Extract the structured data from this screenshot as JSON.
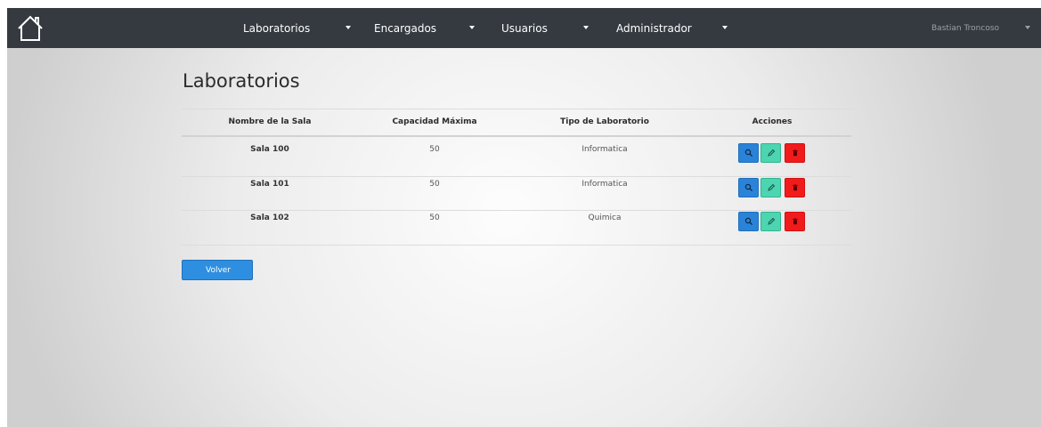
{
  "navbar": {
    "home_icon": "house-outline-icon",
    "items": [
      {
        "label": "Laboratorios"
      },
      {
        "label": "Encargados"
      },
      {
        "label": "Usuarios"
      },
      {
        "label": "Administrador"
      }
    ],
    "user": "Bastian Troncoso",
    "colors": {
      "background": "#343a40",
      "text": "#ffffff",
      "user_text": "#9aa0a6"
    }
  },
  "page": {
    "title": "Laboratorios"
  },
  "table": {
    "headers": [
      "Nombre de la Sala",
      "Capacidad Máxima",
      "Tipo de Laboratorio",
      "Acciones"
    ],
    "rows": [
      {
        "nombre": "Sala 100",
        "capacidad": "50",
        "tipo": "Informatica"
      },
      {
        "nombre": "Sala 101",
        "capacidad": "50",
        "tipo": "Informatica"
      },
      {
        "nombre": "Sala 102",
        "capacidad": "50",
        "tipo": "Quimica"
      }
    ],
    "action_icons": [
      "search-icon",
      "pencil-icon",
      "trash-icon"
    ]
  },
  "buttons": {
    "volver": "Volver"
  },
  "colors": {
    "view_button": "#2b83d8",
    "edit_button": "#4dd4b0",
    "delete_button": "#f21b1b",
    "volver_button": "#2e8fe0"
  }
}
